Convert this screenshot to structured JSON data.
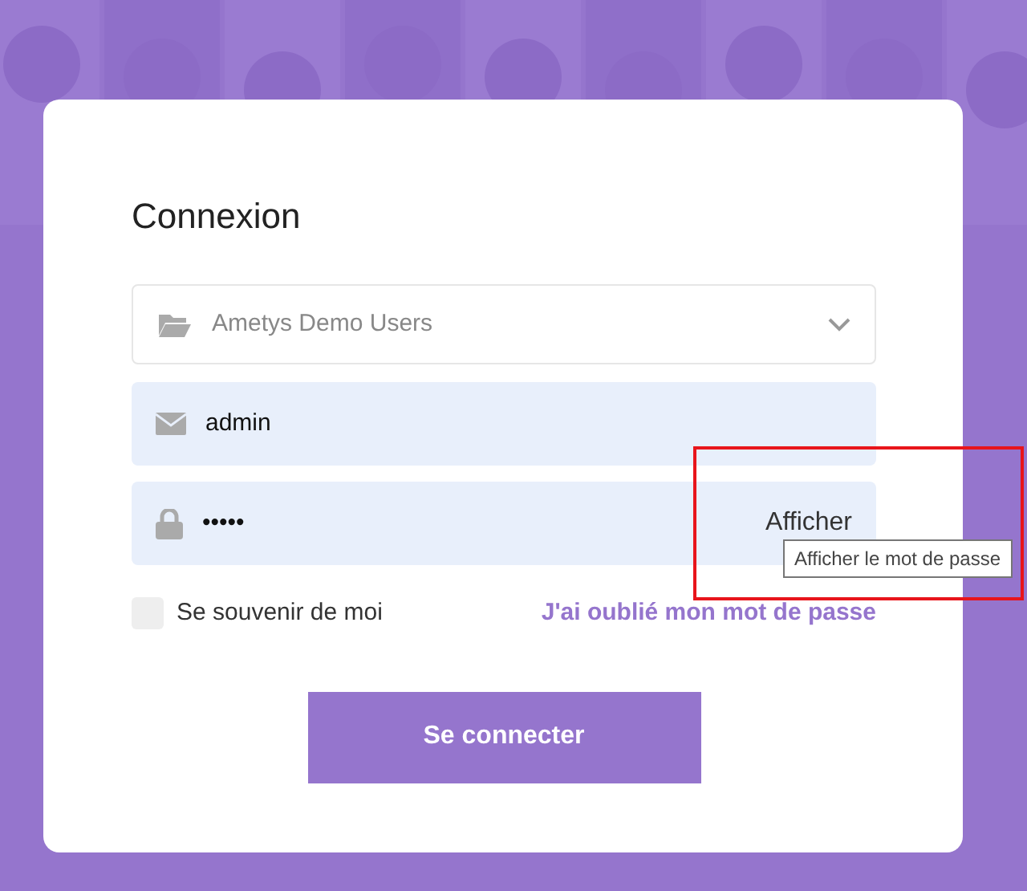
{
  "login": {
    "title": "Connexion",
    "directory": {
      "value": "Ametys Demo Users"
    },
    "username": {
      "value": "admin"
    },
    "password": {
      "value": "•••••",
      "toggle": "Afficher",
      "tooltip": "Afficher le mot de passe"
    },
    "remember": {
      "label": "Se souvenir de moi",
      "checked": false
    },
    "forgot_link": "J'ai oublié mon mot de passe",
    "submit": "Se connecter"
  },
  "annotation": {
    "kind": "highlight-box"
  }
}
